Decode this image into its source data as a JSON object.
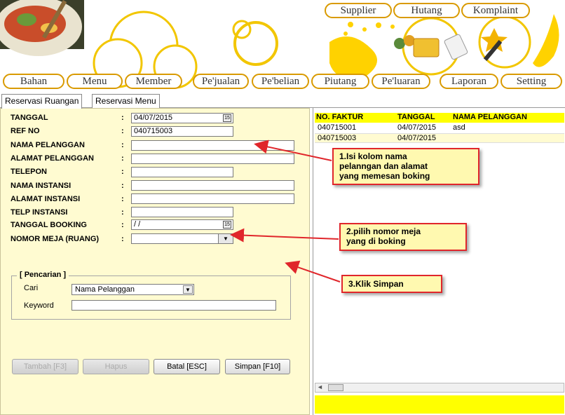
{
  "top_menu": [
    "Supplier",
    "Hutang",
    "Komplaint"
  ],
  "main_menu": [
    "Bahan",
    "Menu",
    "Member",
    "Pe'jualan",
    "Pe'belian",
    "Piutang",
    "Pe'luaran",
    "Laporan",
    "Setting"
  ],
  "tabs": [
    "Reservasi Ruangan",
    "Reservasi Menu"
  ],
  "form": {
    "tanggal": {
      "label": "TANGGAL",
      "value": "04/07/2015"
    },
    "ref_no": {
      "label": "REF NO",
      "value": "040715003"
    },
    "nama_pelanggan": {
      "label": "NAMA PELANGGAN",
      "value": ""
    },
    "alamat_pelanggan": {
      "label": "ALAMAT PELANGGAN",
      "value": ""
    },
    "telepon": {
      "label": "TELEPON",
      "value": ""
    },
    "nama_instansi": {
      "label": "NAMA INSTANSI",
      "value": ""
    },
    "alamat_instansi": {
      "label": "ALAMAT INSTANSI",
      "value": ""
    },
    "telp_instansi": {
      "label": "TELP INSTANSI",
      "value": ""
    },
    "tanggal_booking": {
      "label": "TANGGAL BOOKING",
      "value": "/ /"
    },
    "nomor_meja": {
      "label": "NOMOR MEJA (RUANG)",
      "value": ""
    },
    "colon": ":"
  },
  "buttons": {
    "tambah": "Tambah [F3]",
    "hapus": "Hapus",
    "batal": "Batal [ESC]",
    "simpan": "Simpan [F10]"
  },
  "search": {
    "title": "[ Pencarian ]",
    "cari_label": "Cari",
    "cari_value": "Nama Pelanggan",
    "keyword_label": "Keyword",
    "keyword_value": ""
  },
  "grid": {
    "headers": [
      "NO. FAKTUR",
      "TANGGAL",
      "NAMA PELANGGAN"
    ],
    "rows": [
      {
        "faktur": "040715001",
        "tanggal": "04/07/2015",
        "nama": "asd"
      },
      {
        "faktur": "040715003",
        "tanggal": "04/07/2015",
        "nama": ""
      }
    ]
  },
  "callouts": {
    "c1_l1": "1.Isi kolom nama",
    "c1_l2": "pelanngan dan alamat",
    "c1_l3": "yang memesan boking",
    "c2_l1": "2.pilih nomor meja",
    "c2_l2": "yang di boking",
    "c3": "3.Klik Simpan"
  },
  "colors": {
    "accent": "#ffff00",
    "panel": "#fffbd1",
    "callout_border": "#e0262b",
    "menu_border": "#d99a00"
  }
}
